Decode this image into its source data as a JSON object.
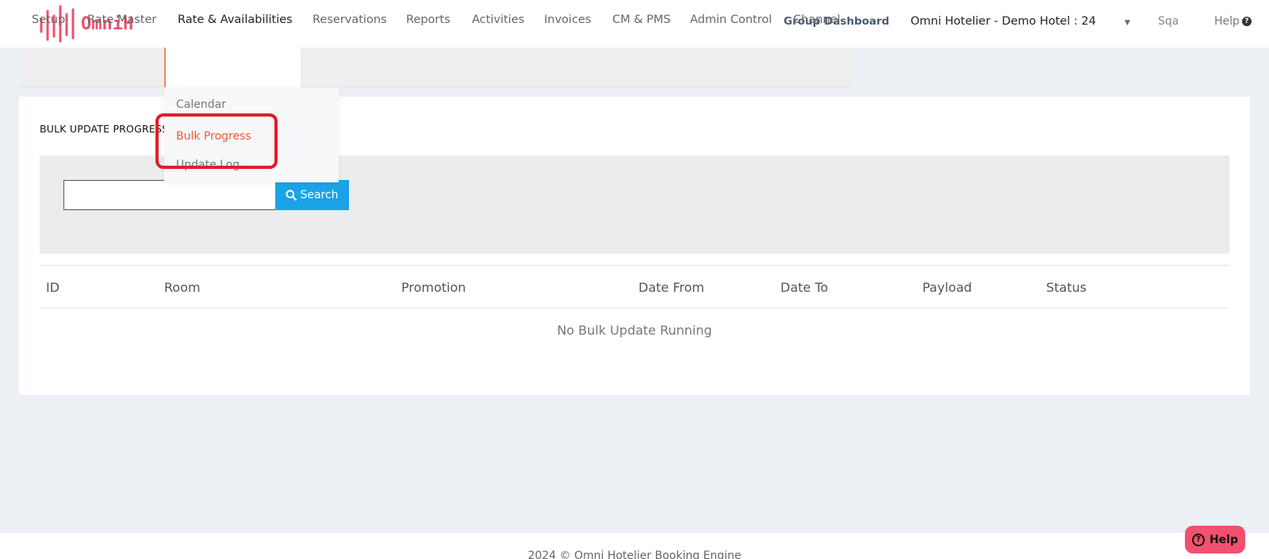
{
  "brand": {
    "name": "OmniH",
    "color": "#f0506e"
  },
  "header": {
    "group_dashboard": "Group Dashboard",
    "hotel_selected": "Omni Hotelier - Demo Hotel : 24",
    "user": "Sqa",
    "help": "Help"
  },
  "nav": {
    "items": [
      {
        "label": "Setup"
      },
      {
        "label": "Rate Master"
      },
      {
        "label": "Rate & Availabilities",
        "active": true
      },
      {
        "label": "Reservations"
      },
      {
        "label": "Reports"
      },
      {
        "label": "Activities"
      },
      {
        "label": "Invoices"
      },
      {
        "label": "CM & PMS"
      },
      {
        "label": "Admin Control"
      },
      {
        "label": "Channel"
      }
    ]
  },
  "dropdown": {
    "items": [
      {
        "label": "Calendar"
      },
      {
        "label": "Bulk Progress",
        "active": true
      },
      {
        "label": "Update Log"
      }
    ]
  },
  "page": {
    "title": "BULK UPDATE PROGRESS",
    "search_value": "",
    "search_button": "Search"
  },
  "table": {
    "columns": [
      "ID",
      "Room",
      "Promotion",
      "Date From",
      "Date To",
      "Payload",
      "Status"
    ],
    "empty_message": "No Bulk Update Running"
  },
  "footer": {
    "text": "2024 © Omni Hotelier Booking Engine"
  },
  "help_button": {
    "label": "Help"
  },
  "colors": {
    "accent": "#ee5a3a",
    "search_button": "#1aa3e8",
    "highlight": "#e01e28"
  }
}
